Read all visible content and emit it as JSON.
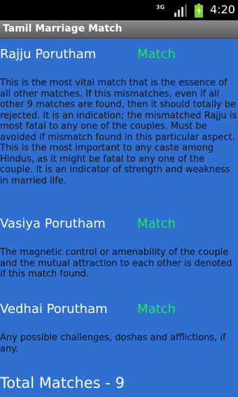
{
  "status_bar": {
    "network": "3G",
    "clock": "4:20"
  },
  "app": {
    "title": "Tamil Marriage Match"
  },
  "matches": [
    {
      "name": "Rajju Porutham",
      "status": "Match",
      "description": "This is the most vital match that is the essence of all other matches. If this mismatches, even if all other 9 matches are found, then it should totally be rejected. It is an indication; the mismatched Rajju is most fatal to any one of the couples. Must be avoided if mismatch found in this particular aspect. This is the most important to any caste among Hindus, as it might be fatal to any one of the couple. It is an indicator of strength and weakness in married life."
    },
    {
      "name": "Vasiya Porutham",
      "status": "Match",
      "description": "The magnetic control or amenability of the couple and the mutual attraction to each other is denoted if this match found."
    },
    {
      "name": "Vedhai Porutham",
      "status": "Match",
      "description": "Any possible challenges, doshas and afflictions, if any."
    }
  ],
  "total": "Total Matches - 9"
}
